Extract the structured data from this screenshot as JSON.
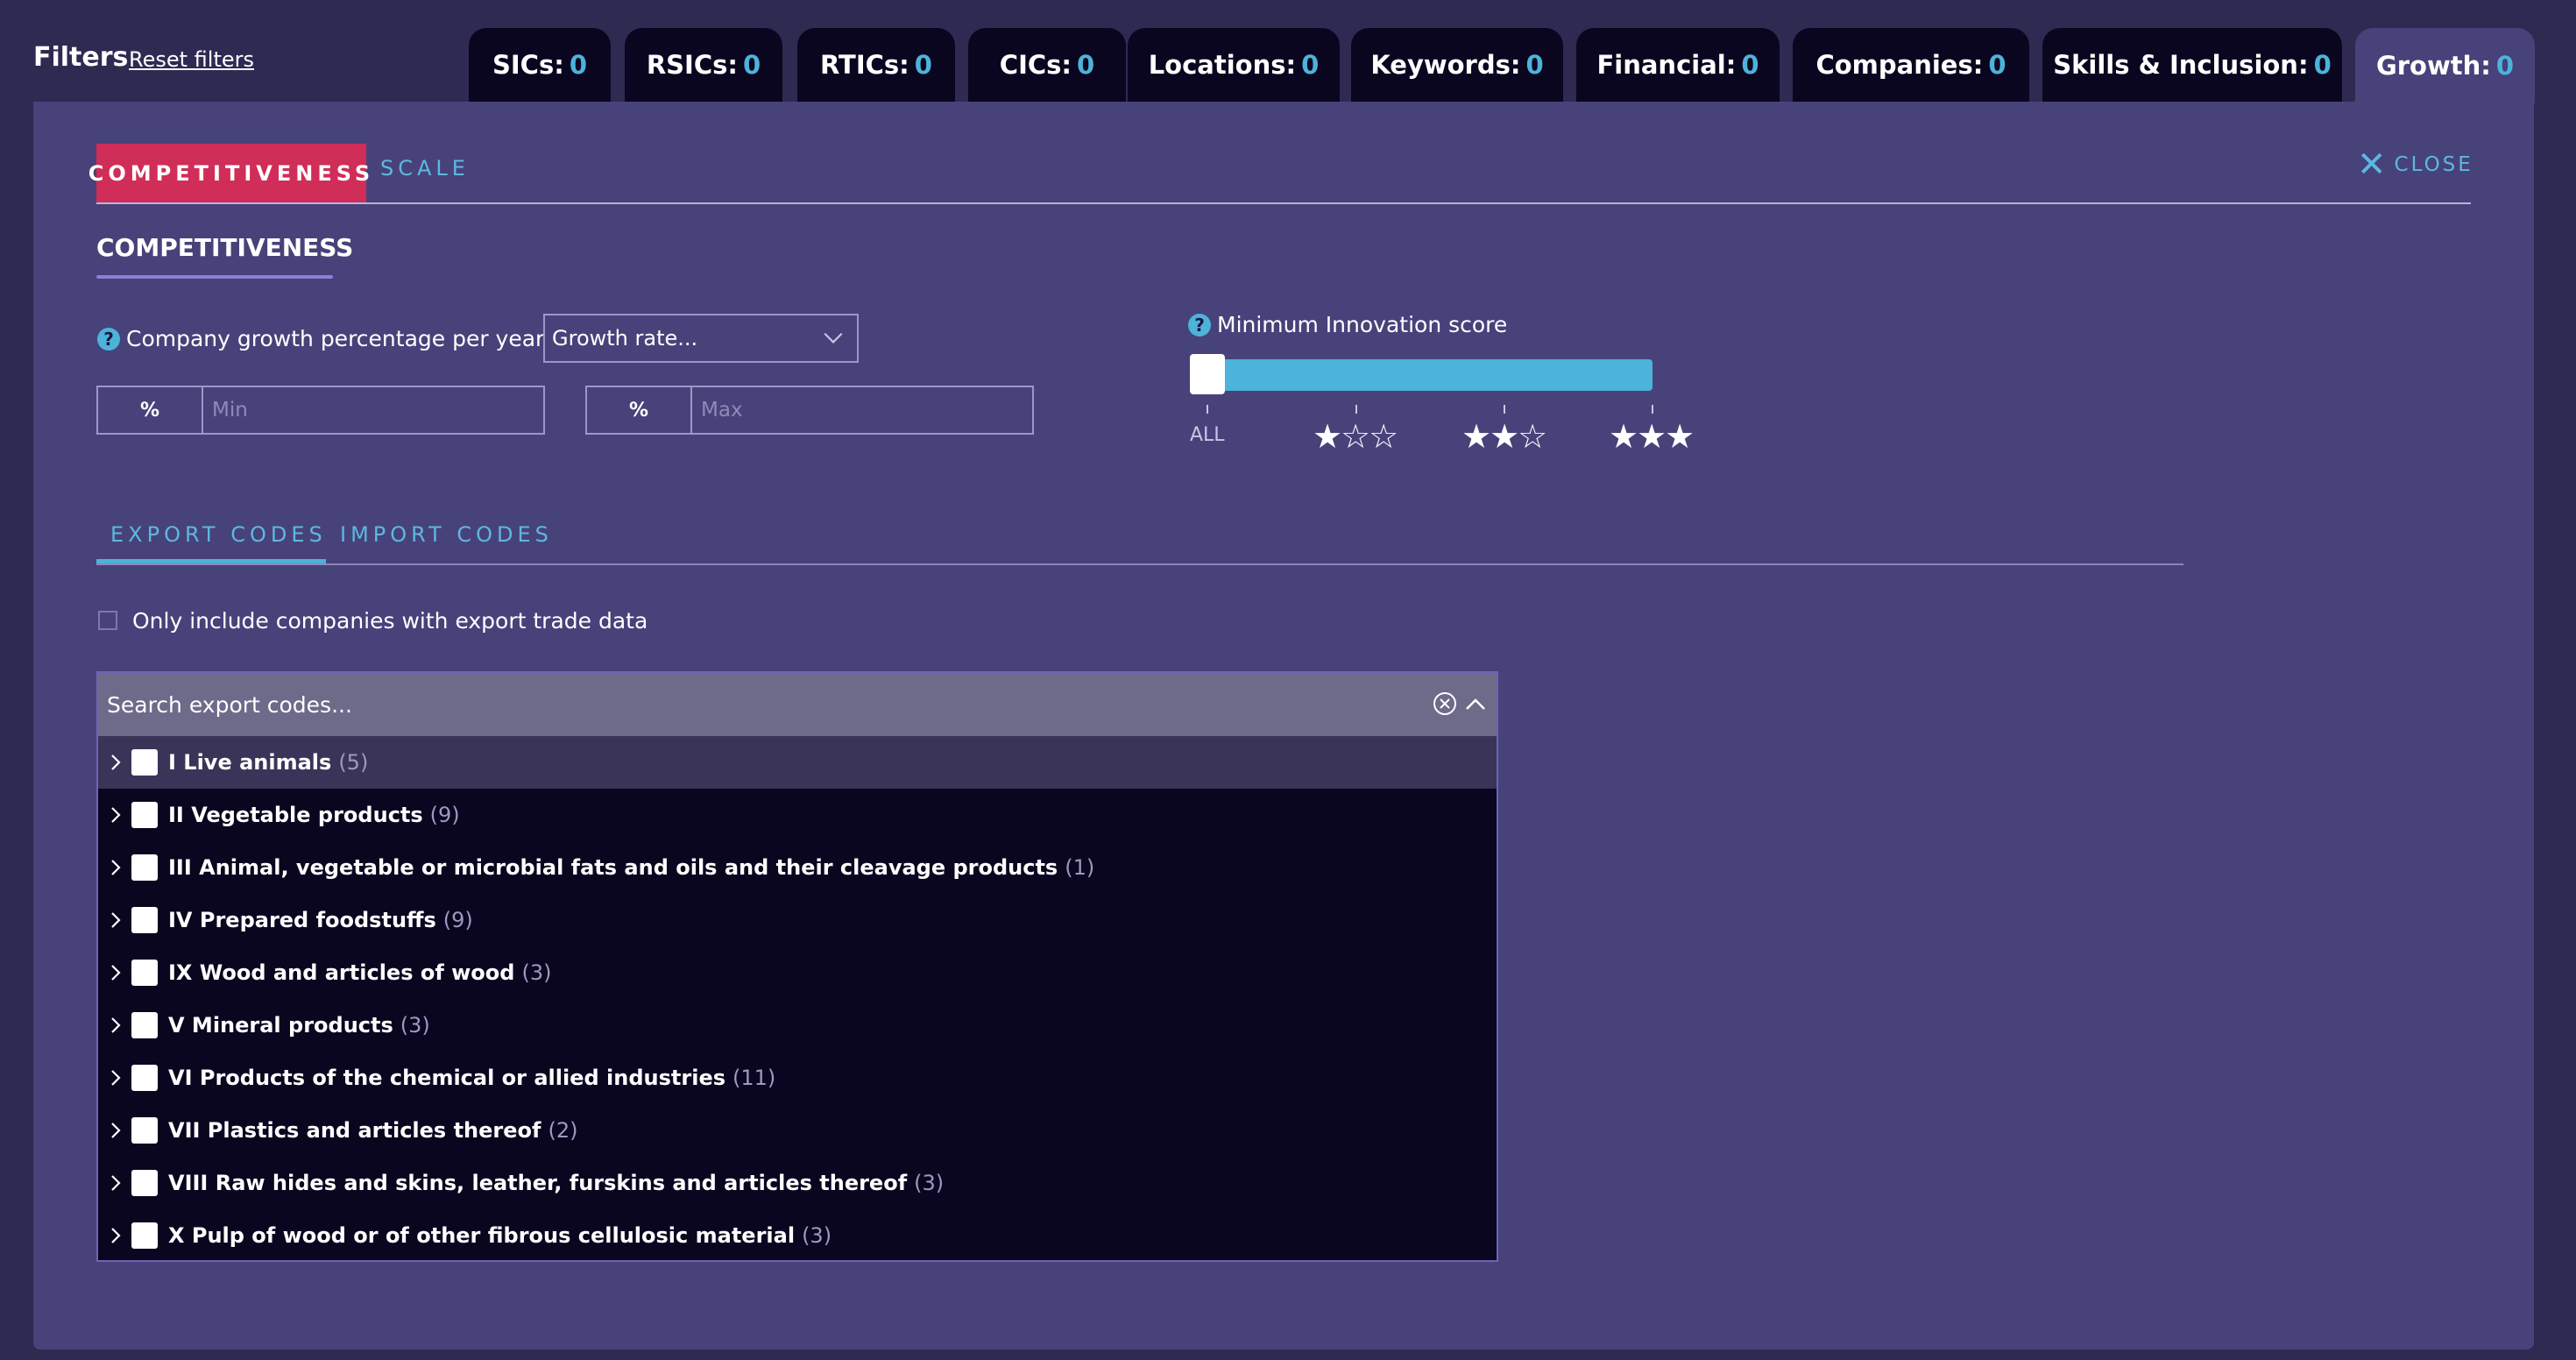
{
  "header": {
    "title": "Filters",
    "reset_label": "Reset filters"
  },
  "tabs": [
    {
      "label": "SICs:",
      "count": "0"
    },
    {
      "label": "RSICs:",
      "count": "0"
    },
    {
      "label": "RTICs:",
      "count": "0"
    },
    {
      "label": "CICs:",
      "count": "0"
    },
    {
      "label": "Locations:",
      "count": "0"
    },
    {
      "label": "Keywords:",
      "count": "0"
    },
    {
      "label": "Financial:",
      "count": "0"
    },
    {
      "label": "Companies:",
      "count": "0"
    },
    {
      "label": "Skills & Inclusion:",
      "count": "0"
    },
    {
      "label": "Growth:",
      "count": "0"
    }
  ],
  "subtabs": {
    "active": "COMPETITIVENESS",
    "other": "SCALE",
    "close": "CLOSE"
  },
  "competitiveness": {
    "title": "COMPETITIVENESS",
    "help_icon": "?",
    "growth_label": "Company growth percentage per year",
    "growth_select": "Growth rate...",
    "pct_symbol": "%",
    "min_placeholder": "Min",
    "max_placeholder": "Max",
    "innovation_label": "Minimum Innovation score",
    "innovation_all": "ALL",
    "innovation_value": 0,
    "star_levels": [
      "★☆☆",
      "★★☆",
      "★★★"
    ]
  },
  "codes": {
    "export_tab": "EXPORT CODES",
    "import_tab": "IMPORT CODES",
    "checkbox_label": "Only include companies with export trade data",
    "search_placeholder": "Search export codes...",
    "items": [
      {
        "name": "I Live animals",
        "count": "(5)"
      },
      {
        "name": "II Vegetable products",
        "count": "(9)"
      },
      {
        "name": "III Animal, vegetable or microbial fats and oils and their cleavage products",
        "count": "(1)"
      },
      {
        "name": "IV Prepared foodstuffs",
        "count": "(9)"
      },
      {
        "name": "IX Wood and articles of wood",
        "count": "(3)"
      },
      {
        "name": "V Mineral products",
        "count": "(3)"
      },
      {
        "name": "VI Products of the chemical or allied industries",
        "count": "(11)"
      },
      {
        "name": "VII Plastics and articles thereof",
        "count": "(2)"
      },
      {
        "name": "VIII Raw hides and skins, leather, furskins and articles thereof",
        "count": "(3)"
      },
      {
        "name": "X Pulp of wood or of other fibrous cellulosic material",
        "count": "(3)"
      }
    ]
  },
  "colors": {
    "background": "#2e2a52",
    "panel": "#48427a",
    "tab_dark": "#0a0620",
    "accent_blue": "#4cb3da",
    "accent_pink": "#d02d58"
  }
}
